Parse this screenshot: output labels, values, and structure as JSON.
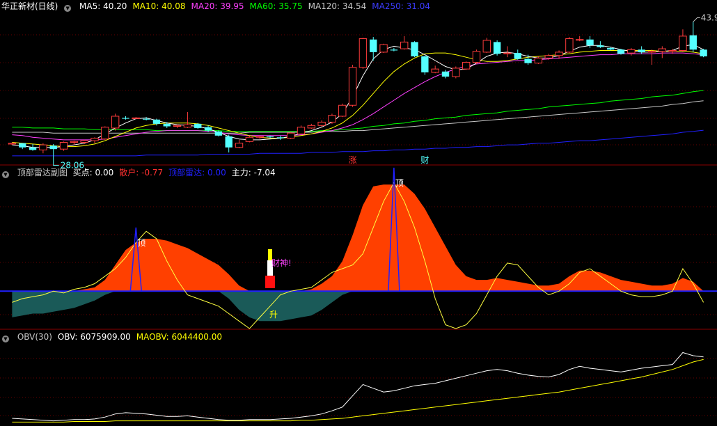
{
  "colors": {
    "bg": "#000000",
    "grid": "#8b0000",
    "up": "#ff3c3c",
    "down": "#54ffff",
    "ma5": "#ffffff",
    "ma10": "#ffff00",
    "ma20": "#ff40ff",
    "ma60": "#00ff00",
    "ma120": "#c8c8c8",
    "ma250": "#2020ff",
    "retail": "#ff4000",
    "main": "#1a5a58",
    "line": "#ffff40",
    "obv": "#ffffff",
    "maobv": "#ffff00"
  },
  "panel1": {
    "title": "华正新材(日线)",
    "ma": [
      {
        "label": "MA5: 40.20",
        "color": "#ffffff"
      },
      {
        "label": "MA10: 40.08",
        "color": "#ffff00"
      },
      {
        "label": "MA20: 39.95",
        "color": "#ff40ff"
      },
      {
        "label": "MA60: 35.75",
        "color": "#00ff00"
      },
      {
        "label": "MA120: 34.54",
        "color": "#c8c8c8"
      },
      {
        "label": "MA250: 31.04",
        "color": "#3c3cff"
      }
    ],
    "high_label": "43.90",
    "low_label": "28.06",
    "marker_zhang": "涨",
    "marker_cai": "财"
  },
  "panel2": {
    "title": "顶部雷达副图",
    "fields": [
      {
        "label": "买点: 0.00",
        "color": "#ffffff"
      },
      {
        "label": "散户: -0.77",
        "color": "#ff3030"
      },
      {
        "label": "顶部雷达: 0.00",
        "color": "#2020ff"
      },
      {
        "label": "主力: -7.04",
        "color": "#ffffff"
      }
    ],
    "top_label_1": "顶",
    "top_label_2": "顶",
    "sheng_label": "升",
    "caishen_label": "财神!"
  },
  "panel3": {
    "title": "OBV(30)",
    "fields": [
      {
        "label": "OBV: 6075909.00",
        "color": "#ffffff"
      },
      {
        "label": "MAOBV: 6044400.00",
        "color": "#ffff00"
      }
    ]
  },
  "chart_data": [
    {
      "type": "candlestick",
      "title": "华正新材(日线)",
      "ylim": [
        27,
        45
      ],
      "candles": [
        [
          29.4,
          29.6,
          29.3,
          29.5
        ],
        [
          29.5,
          29.5,
          28.8,
          29.0
        ],
        [
          29.0,
          29.4,
          28.6,
          28.7
        ],
        [
          28.7,
          29.5,
          28.3,
          29.3
        ],
        [
          29.2,
          29.4,
          28.1,
          28.8
        ],
        [
          28.8,
          29.7,
          28.6,
          29.6
        ],
        [
          29.6,
          29.8,
          29.3,
          29.7
        ],
        [
          29.6,
          29.9,
          29.4,
          29.8
        ],
        [
          29.8,
          30.2,
          29.5,
          30.1
        ],
        [
          30.0,
          31.5,
          29.9,
          31.4
        ],
        [
          31.3,
          33.0,
          31.0,
          32.7
        ],
        [
          32.5,
          32.7,
          32.3,
          32.4
        ],
        [
          32.5,
          32.6,
          32.4,
          32.5
        ],
        [
          32.4,
          32.6,
          32.2,
          32.3
        ],
        [
          32.3,
          32.4,
          31.6,
          31.8
        ],
        [
          31.8,
          32.0,
          31.3,
          31.5
        ],
        [
          31.5,
          31.7,
          31.3,
          31.6
        ],
        [
          31.4,
          33.2,
          31.3,
          31.7
        ],
        [
          31.8,
          31.9,
          31.2,
          31.3
        ],
        [
          31.4,
          31.6,
          30.8,
          31.0
        ],
        [
          30.9,
          31.0,
          30.3,
          30.4
        ],
        [
          30.3,
          30.5,
          28.4,
          29.0
        ],
        [
          29.0,
          29.9,
          28.9,
          29.5
        ],
        [
          29.7,
          30.4,
          29.6,
          30.2
        ],
        [
          30.2,
          30.4,
          30.0,
          30.3
        ],
        [
          30.3,
          30.4,
          30.1,
          30.2
        ],
        [
          30.2,
          30.4,
          29.9,
          30.1
        ],
        [
          30.1,
          30.8,
          30.0,
          30.7
        ],
        [
          30.6,
          31.6,
          30.5,
          31.4
        ],
        [
          31.3,
          31.8,
          31.2,
          31.6
        ],
        [
          31.6,
          32.2,
          31.4,
          32.0
        ],
        [
          32.0,
          33.0,
          31.8,
          32.8
        ],
        [
          32.7,
          34.2,
          32.6,
          34.0
        ],
        [
          34.0,
          38.8,
          33.8,
          38.5
        ],
        [
          38.5,
          42.0,
          38.3,
          41.9
        ],
        [
          41.8,
          42.1,
          39.3,
          40.3
        ],
        [
          40.3,
          41.3,
          40.2,
          41.2
        ],
        [
          40.6,
          40.8,
          40.4,
          40.5
        ],
        [
          40.7,
          42.2,
          40.6,
          41.5
        ],
        [
          41.5,
          41.6,
          39.7,
          39.8
        ],
        [
          39.8,
          39.9,
          37.6,
          37.9
        ],
        [
          37.9,
          38.7,
          37.8,
          38.3
        ],
        [
          38.0,
          38.2,
          37.2,
          37.4
        ],
        [
          37.4,
          38.6,
          37.2,
          38.4
        ],
        [
          38.3,
          39.2,
          38.2,
          39.1
        ],
        [
          39.1,
          40.6,
          38.9,
          40.4
        ],
        [
          40.3,
          42.0,
          40.2,
          41.7
        ],
        [
          41.5,
          41.7,
          39.9,
          40.1
        ],
        [
          40.1,
          41.0,
          39.7,
          40.2
        ],
        [
          40.2,
          40.6,
          39.4,
          39.5
        ],
        [
          39.5,
          40.0,
          38.8,
          39.0
        ],
        [
          39.0,
          39.8,
          38.9,
          39.6
        ],
        [
          39.6,
          40.1,
          39.4,
          39.9
        ],
        [
          39.9,
          40.5,
          39.5,
          40.3
        ],
        [
          40.3,
          42.1,
          40.2,
          41.9
        ],
        [
          41.8,
          42.2,
          41.6,
          41.8
        ],
        [
          41.8,
          42.2,
          40.8,
          41.1
        ],
        [
          41.1,
          41.6,
          40.8,
          40.9
        ],
        [
          40.8,
          40.9,
          40.5,
          40.6
        ],
        [
          40.6,
          40.7,
          40.0,
          40.1
        ],
        [
          40.2,
          40.8,
          39.9,
          40.6
        ],
        [
          40.6,
          41.0,
          40.1,
          40.3
        ],
        [
          40.3,
          40.6,
          38.8,
          40.4
        ],
        [
          40.4,
          41.0,
          39.6,
          40.7
        ],
        [
          40.4,
          40.7,
          40.1,
          40.5
        ],
        [
          40.5,
          43.0,
          40.3,
          42.2
        ],
        [
          42.3,
          43.9,
          40.3,
          40.6
        ],
        [
          40.6,
          40.7,
          39.7,
          39.8
        ]
      ],
      "ma5": [
        29.3,
        29.2,
        29.0,
        29.0,
        29.0,
        29.1,
        29.3,
        29.5,
        29.9,
        30.6,
        31.3,
        31.9,
        32.4,
        32.5,
        32.2,
        31.9,
        31.7,
        31.6,
        31.5,
        31.2,
        30.8,
        30.3,
        30.0,
        29.9,
        29.9,
        30.0,
        30.1,
        30.3,
        30.7,
        31.0,
        31.4,
        32.0,
        33.0,
        35.0,
        37.5,
        39.5,
        40.6,
        41.0,
        40.8,
        40.6,
        40.0,
        39.3,
        38.6,
        38.2,
        38.3,
        39.0,
        39.8,
        40.2,
        40.3,
        40.1,
        39.8,
        39.6,
        39.6,
        39.9,
        40.4,
        40.9,
        41.1,
        41.1,
        40.9,
        40.6,
        40.4,
        40.3,
        40.3,
        40.4,
        40.5,
        41.0,
        41.2,
        40.6
      ],
      "ma10": [
        29.6,
        29.5,
        29.4,
        29.3,
        29.2,
        29.1,
        29.1,
        29.2,
        29.4,
        29.8,
        30.3,
        30.8,
        31.3,
        31.6,
        31.8,
        31.9,
        31.9,
        31.9,
        31.8,
        31.6,
        31.3,
        31.0,
        30.7,
        30.4,
        30.2,
        30.1,
        30.1,
        30.2,
        30.4,
        30.6,
        30.9,
        31.3,
        31.9,
        32.8,
        34.0,
        35.4,
        36.8,
        38.0,
        38.9,
        39.6,
        40.1,
        40.2,
        40.2,
        40.0,
        39.7,
        39.4,
        39.2,
        39.2,
        39.3,
        39.5,
        39.7,
        39.8,
        39.9,
        40.0,
        40.1,
        40.3,
        40.4,
        40.5,
        40.5,
        40.5,
        40.5,
        40.5,
        40.5,
        40.4,
        40.4,
        40.4,
        40.3,
        40.1
      ],
      "ma20": [
        30.5,
        30.4,
        30.2,
        30.1,
        30.0,
        29.9,
        29.9,
        29.9,
        29.9,
        30.0,
        30.2,
        30.4,
        30.6,
        30.8,
        30.9,
        31.0,
        31.0,
        31.0,
        31.0,
        30.9,
        30.8,
        30.6,
        30.5,
        30.4,
        30.4,
        30.4,
        30.4,
        30.4,
        30.5,
        30.6,
        30.8,
        31.0,
        31.3,
        31.7,
        32.3,
        33.0,
        33.8,
        34.6,
        35.4,
        36.1,
        36.8,
        37.4,
        37.9,
        38.3,
        38.6,
        38.9,
        39.0,
        39.1,
        39.2,
        39.3,
        39.3,
        39.4,
        39.5,
        39.6,
        39.7,
        39.8,
        39.9,
        40.0,
        40.0,
        40.1,
        40.1,
        40.1,
        40.1,
        40.2,
        40.2,
        40.2,
        40.1,
        40.0
      ],
      "ma60": [
        31.4,
        31.4,
        31.3,
        31.3,
        31.3,
        31.2,
        31.2,
        31.2,
        31.1,
        31.1,
        31.1,
        31.1,
        31.1,
        31.1,
        31.0,
        31.0,
        31.0,
        31.0,
        31.0,
        31.0,
        31.0,
        30.9,
        30.9,
        30.9,
        30.9,
        30.9,
        30.9,
        30.9,
        30.9,
        30.9,
        31.0,
        31.0,
        31.1,
        31.2,
        31.3,
        31.5,
        31.6,
        31.8,
        31.9,
        32.1,
        32.2,
        32.4,
        32.5,
        32.6,
        32.8,
        32.9,
        33.0,
        33.1,
        33.3,
        33.4,
        33.5,
        33.6,
        33.8,
        33.9,
        34.0,
        34.1,
        34.2,
        34.3,
        34.5,
        34.6,
        34.7,
        34.8,
        35.0,
        35.1,
        35.2,
        35.4,
        35.6,
        35.75
      ],
      "ma120": [
        30.8,
        30.8,
        30.8,
        30.8,
        30.7,
        30.7,
        30.7,
        30.7,
        30.7,
        30.7,
        30.7,
        30.7,
        30.7,
        30.7,
        30.7,
        30.7,
        30.7,
        30.7,
        30.7,
        30.7,
        30.7,
        30.7,
        30.7,
        30.8,
        30.8,
        30.8,
        30.8,
        30.8,
        30.8,
        30.8,
        30.9,
        30.9,
        30.9,
        31.0,
        31.0,
        31.1,
        31.2,
        31.3,
        31.4,
        31.5,
        31.6,
        31.7,
        31.8,
        31.9,
        32.0,
        32.1,
        32.2,
        32.3,
        32.4,
        32.5,
        32.6,
        32.7,
        32.8,
        32.9,
        33.0,
        33.1,
        33.2,
        33.3,
        33.4,
        33.5,
        33.6,
        33.7,
        33.8,
        33.9,
        34.1,
        34.2,
        34.4,
        34.54
      ],
      "ma250": [
        28.0,
        28.0,
        28.0,
        28.0,
        28.0,
        28.0,
        28.0,
        28.0,
        28.0,
        28.0,
        28.0,
        28.0,
        28.0,
        28.1,
        28.1,
        28.1,
        28.1,
        28.1,
        28.1,
        28.2,
        28.2,
        28.2,
        28.2,
        28.2,
        28.3,
        28.3,
        28.3,
        28.3,
        28.3,
        28.4,
        28.4,
        28.4,
        28.5,
        28.5,
        28.5,
        28.6,
        28.6,
        28.7,
        28.7,
        28.8,
        28.8,
        28.9,
        28.9,
        29.0,
        29.0,
        29.1,
        29.1,
        29.2,
        29.3,
        29.3,
        29.4,
        29.5,
        29.5,
        29.6,
        29.7,
        29.8,
        29.8,
        29.9,
        30.0,
        30.1,
        30.2,
        30.3,
        30.4,
        30.5,
        30.6,
        30.8,
        30.9,
        31.04
      ]
    },
    {
      "type": "area",
      "title": "顶部雷达副图",
      "ylim": [
        -10,
        30
      ],
      "retail": [
        0,
        0,
        0,
        0,
        0,
        0,
        0,
        0.5,
        1,
        3,
        7,
        11,
        13,
        14,
        14,
        13.5,
        12.5,
        11.5,
        10,
        8.5,
        7,
        4.5,
        1.5,
        0,
        0,
        0,
        0,
        0,
        0,
        0.5,
        2,
        4,
        8,
        15,
        23,
        28,
        28.5,
        28.5,
        28.5,
        26,
        22,
        17,
        12,
        7,
        4,
        3,
        3,
        3.5,
        3,
        2.5,
        2,
        1.5,
        1.5,
        2,
        4,
        5.5,
        5.5,
        5,
        4,
        3,
        2.5,
        2,
        1.5,
        1.5,
        2,
        3.5,
        2.5,
        0
      ],
      "main": [
        -7,
        -6.5,
        -6,
        -6,
        -5.5,
        -5,
        -4.5,
        -3.5,
        -2.5,
        -1,
        0,
        0,
        0,
        0,
        0,
        0,
        0,
        0,
        0,
        0,
        0,
        -2,
        -5,
        -7,
        -8,
        -8,
        -8,
        -7.5,
        -7,
        -6.5,
        -5,
        -3,
        -1,
        0,
        0,
        0,
        0,
        0,
        0,
        0,
        0,
        0,
        0,
        0,
        0,
        0,
        0,
        0,
        0,
        0,
        0,
        0,
        0,
        0,
        0,
        0,
        0,
        0,
        0,
        0,
        0,
        0,
        0,
        0,
        0,
        0,
        0,
        0
      ],
      "line": [
        -3,
        -2,
        -1.5,
        -1,
        0,
        -0.5,
        0.5,
        1,
        2,
        4,
        6,
        9,
        13,
        16,
        14,
        8,
        3,
        -1,
        -2,
        -3,
        -4,
        -6,
        -8,
        -10,
        -7,
        -4,
        -1,
        0,
        0.5,
        1,
        3,
        5,
        6,
        7,
        10,
        17,
        24,
        29,
        24,
        17,
        8,
        -2,
        -9,
        -10,
        -9,
        -6,
        -1,
        4,
        7.5,
        7,
        4,
        1,
        -1,
        0,
        2,
        5,
        6,
        4,
        2,
        0,
        -1,
        -1.5,
        -1.5,
        -1,
        0,
        6,
        2,
        -3
      ],
      "top_marks": [
        12,
        37
      ],
      "buy_mark": 25
    },
    {
      "type": "line",
      "title": "OBV(30)",
      "series": [
        {
          "name": "OBV",
          "values": [
            5.1,
            5.09,
            5.08,
            5.07,
            5.06,
            5.07,
            5.08,
            5.08,
            5.09,
            5.12,
            5.17,
            5.19,
            5.18,
            5.17,
            5.15,
            5.13,
            5.13,
            5.14,
            5.12,
            5.1,
            5.08,
            5.07,
            5.07,
            5.08,
            5.08,
            5.08,
            5.09,
            5.1,
            5.12,
            5.14,
            5.17,
            5.22,
            5.28,
            5.46,
            5.64,
            5.58,
            5.52,
            5.54,
            5.58,
            5.62,
            5.64,
            5.66,
            5.7,
            5.74,
            5.78,
            5.82,
            5.86,
            5.88,
            5.86,
            5.82,
            5.79,
            5.77,
            5.76,
            5.8,
            5.88,
            5.93,
            5.9,
            5.88,
            5.86,
            5.84,
            5.87,
            5.9,
            5.92,
            5.94,
            5.96,
            6.15,
            6.1,
            6.08
          ]
        },
        {
          "name": "MAOBV",
          "values": [
            5.04,
            5.04,
            5.04,
            5.04,
            5.04,
            5.04,
            5.05,
            5.05,
            5.05,
            5.05,
            5.06,
            5.06,
            5.06,
            5.06,
            5.06,
            5.06,
            5.06,
            5.06,
            5.06,
            5.06,
            5.06,
            5.06,
            5.06,
            5.06,
            5.06,
            5.06,
            5.06,
            5.06,
            5.07,
            5.07,
            5.08,
            5.09,
            5.1,
            5.12,
            5.14,
            5.16,
            5.18,
            5.2,
            5.22,
            5.24,
            5.26,
            5.28,
            5.3,
            5.32,
            5.34,
            5.36,
            5.38,
            5.4,
            5.42,
            5.44,
            5.46,
            5.48,
            5.5,
            5.52,
            5.55,
            5.58,
            5.61,
            5.64,
            5.67,
            5.7,
            5.73,
            5.76,
            5.8,
            5.84,
            5.88,
            5.94,
            6.0,
            6.04
          ]
        }
      ],
      "ylim": [
        5.0,
        6.3
      ]
    }
  ]
}
